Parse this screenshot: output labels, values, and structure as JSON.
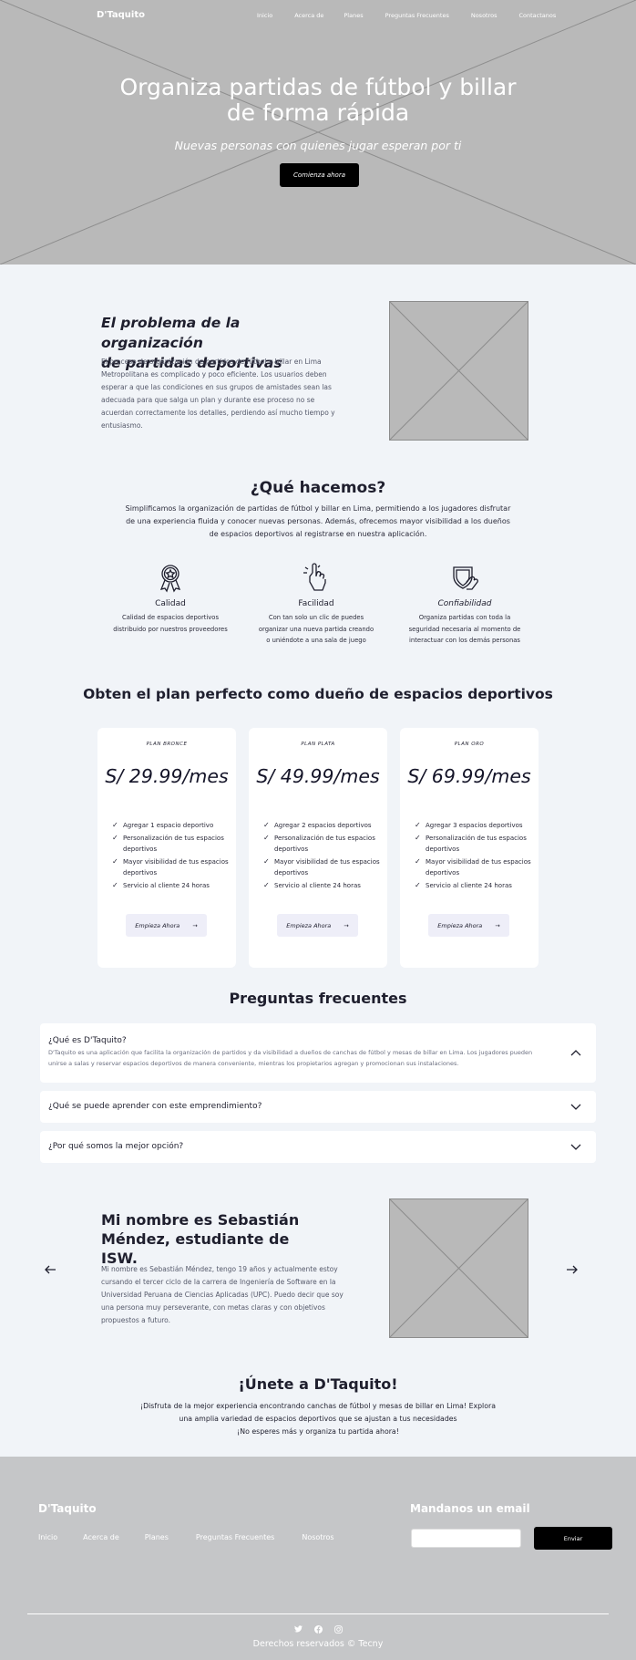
{
  "nav": {
    "brand": "D'Taquito",
    "links": [
      "Inicio",
      "Acerca de",
      "Planes",
      "Preguntas Frecuentes",
      "Nosotros",
      "Contactanos"
    ]
  },
  "hero": {
    "title_line1": "Organiza partidas de fútbol y billar",
    "title_line2": "de forma rápida",
    "subtitle": "Nuevas personas con quienes jugar esperan por ti",
    "cta": "Comienza ahora"
  },
  "problem": {
    "title_line1": "El problema de la organización",
    "title_line2": "de partidas deportivas",
    "text": "El proceso de organización de partidos de fútbol y billar en Lima Metropolitana es complicado y poco eficiente. Los usuarios deben esperar a que las condiciones en sus grupos de amistades sean las adecuada para que salga un plan y durante ese proceso no se acuerdan correctamente los detalles, perdiendo así mucho tiempo y entusiasmo."
  },
  "what": {
    "title": "¿Qué hacemos?",
    "text": "Simplificamos la organización de partidas de fútbol y billar en Lima, permitiendo a los jugadores disfrutar de una experiencia fluida y conocer nuevas personas. Además, ofrecemos mayor visibilidad a los dueños de espacios deportivos al registrarse en nuestra aplicación.",
    "features": [
      {
        "icon": "award-icon",
        "title": "Calidad",
        "text": "Calidad de espacios deportivos distribuido por nuestros proveedores"
      },
      {
        "icon": "tap-hand-icon",
        "title": "Facilidad",
        "text": "Con tan solo un clic de puedes organizar una nueva partida creando o uniéndote a una sala de juego"
      },
      {
        "icon": "shield-hand-icon",
        "title": "Confiabilidad",
        "text": "Organiza partidas con toda la seguridad necesaria al momento de interactuar con los demás personas"
      }
    ]
  },
  "plans": {
    "title": "Obten el plan perfecto como dueño de espacios deportivos",
    "items": [
      {
        "name": "PLAN BRONCE",
        "price": "S/ 29.99/mes",
        "features": [
          "Agregar 1 espacio deportivo",
          "Personalización de tus espacios deportivos",
          "Mayor visibilidad de tus espacios deportivos",
          "Servicio al cliente 24 horas"
        ],
        "cta": "Empieza Ahora"
      },
      {
        "name": "PLAN PLATA",
        "price": "S/ 49.99/mes",
        "features": [
          "Agregar 2 espacios deportivos",
          "Personalización de tus espacios deportivos",
          "Mayor visibilidad de tus espacios deportivos",
          "Servicio al cliente 24 horas"
        ],
        "cta": "Empieza Ahora"
      },
      {
        "name": "PLAN ORO",
        "price": "S/ 69.99/mes",
        "features": [
          "Agregar 3 espacios deportivos",
          "Personalización de tus espacios deportivos",
          "Mayor visibilidad de tus espacios deportivos",
          "Servicio al cliente 24 horas"
        ],
        "cta": "Empieza Ahora"
      }
    ]
  },
  "faq": {
    "title": "Preguntas frecuentes",
    "items": [
      {
        "q": "¿Qué es D'Taquito?",
        "a": "D'Taquito es una aplicación que facilita la organización de partidos y da visibilidad a dueños de canchas de fútbol y mesas de billar en Lima. Los jugadores pueden unirse a salas y reservar espacios deportivos de manera conveniente, mientras los propietarios agregan y promocionan sus instalaciones.",
        "open": true
      },
      {
        "q": "¿Qué se puede aprender con este emprendimiento?",
        "a": "",
        "open": false
      },
      {
        "q": "¿Por qué somos la mejor opción?",
        "a": "",
        "open": false
      }
    ]
  },
  "bio": {
    "title_line1": "Mi nombre es Sebastián",
    "title_line2": "Méndez, estudiante de ISW.",
    "text": "Mi nombre es Sebastián Méndez, tengo 19 años y actualmente estoy cursando el tercer ciclo de la carrera de Ingeniería de Software en la Universidad Peruana de Ciencias Aplicadas (UPC). Puedo decir que soy una persona muy perseverante, con metas claras y con objetivos propuestos a futuro."
  },
  "join": {
    "title": "¡Únete a D'Taquito!",
    "line1": "¡Disfruta de la mejor experiencia encontrando canchas de fútbol y mesas de billar en Lima! Explora",
    "line2": "una amplia variedad de espacios deportivos que se ajustan a tus necesidades",
    "line3": "¡No esperes más y organiza tu partida ahora!"
  },
  "footer": {
    "brand": "D'Taquito",
    "links": [
      "Inicio",
      "Acerca de",
      "Planes",
      "Preguntas Frecuentes",
      "Nosotros"
    ],
    "mail_title": "Mandanos un email",
    "email_placeholder": "",
    "send": "Enviar",
    "social": [
      "twitter-icon",
      "facebook-icon",
      "instagram-icon"
    ],
    "copyright": "Derechos reservados © Tecny"
  }
}
